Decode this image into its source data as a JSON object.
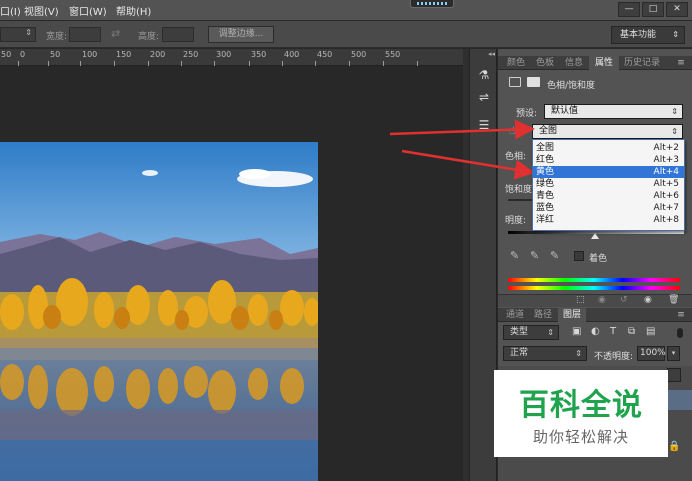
{
  "menubar": {
    "items": [
      "口(I)",
      "视图(V)",
      "窗口(W)",
      "帮助(H)"
    ],
    "window_controls": [
      "—",
      "□",
      "✕"
    ]
  },
  "options_bar": {
    "width_label": "宽度:",
    "height_label": "高度:",
    "refine_edge_label": "调整边缘...",
    "workspace_label": "基本功能"
  },
  "ruler": {
    "ticks": [
      "50",
      "0",
      "50",
      "100",
      "150",
      "200",
      "250",
      "300",
      "350",
      "400",
      "450",
      "500",
      "550"
    ]
  },
  "panel": {
    "tabs": [
      "颜色",
      "色板",
      "信息",
      "属性",
      "历史记录"
    ],
    "active_tab": "属性",
    "title": "色相/饱和度",
    "preset_label": "预设:",
    "preset_value": "默认值",
    "channel_value": "全图",
    "hue_label": "色相:",
    "saturation_label": "饱和度:",
    "lightness_label": "明度:",
    "colorize_label": "着色"
  },
  "dropdown": {
    "items": [
      {
        "name": "全图",
        "shortcut": "Alt+2"
      },
      {
        "name": "红色",
        "shortcut": "Alt+3"
      },
      {
        "name": "黄色",
        "shortcut": "Alt+4"
      },
      {
        "name": "绿色",
        "shortcut": "Alt+5"
      },
      {
        "name": "青色",
        "shortcut": "Alt+6"
      },
      {
        "name": "蓝色",
        "shortcut": "Alt+7"
      },
      {
        "name": "洋红",
        "shortcut": "Alt+8"
      }
    ],
    "highlighted": "黄色"
  },
  "layers": {
    "tabs": [
      "通道",
      "路径",
      "图层"
    ],
    "active_tab": "图层",
    "kind_label": "类型",
    "blend_mode": "正常",
    "opacity_label": "不透明度:",
    "opacity_value": "100%"
  },
  "watermark": {
    "title": "百科全说",
    "subtitle": "助你轻松解决"
  },
  "colors": {
    "accent_arrow": "#e03030",
    "highlight": "#3375d7",
    "watermark_green": "#1fa34d"
  }
}
